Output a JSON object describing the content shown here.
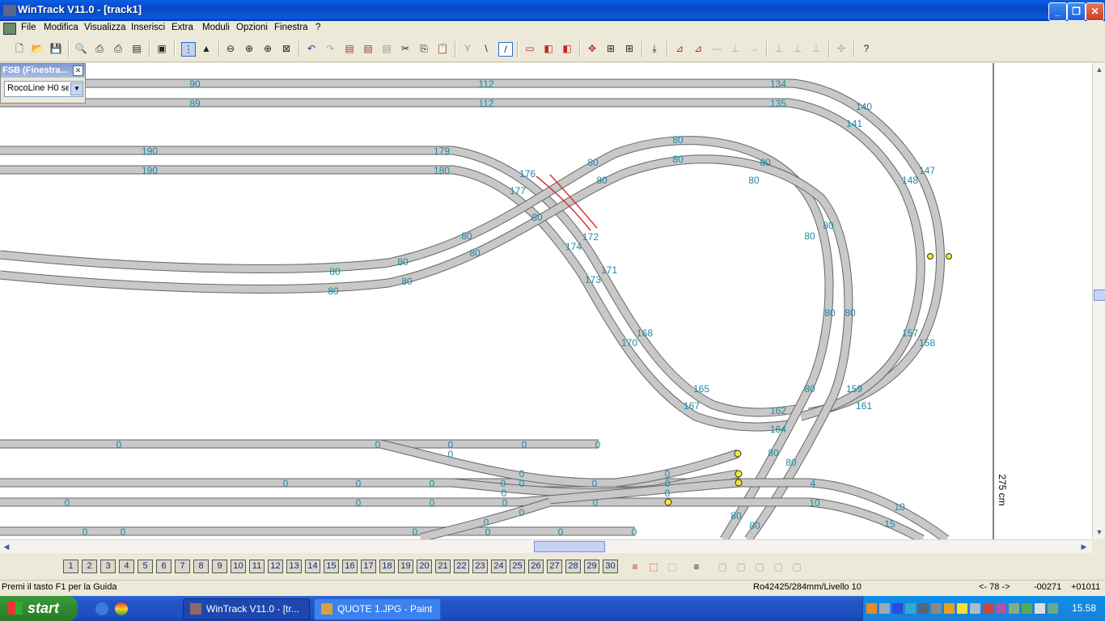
{
  "window": {
    "title": "WinTrack  V11.0 - [track1]"
  },
  "menu": [
    "File",
    "Modifica",
    "Visualizza",
    "Inserisci",
    "Extra",
    "Moduli",
    "Opzioni",
    "Finestra",
    "?"
  ],
  "fsb": {
    "title": "FSB (Finestra...",
    "selected": "RocoLine H0 se"
  },
  "track_labels": [
    "90",
    "112",
    "134",
    "89",
    "112",
    "135",
    "140",
    "141",
    "148",
    "147",
    "190",
    "179",
    "190",
    "180",
    "176",
    "177",
    "172",
    "174",
    "171",
    "173",
    "168",
    "170",
    "165",
    "167",
    "162",
    "164",
    "159",
    "161",
    "157",
    "158",
    "80",
    "0",
    "4",
    "10",
    "15"
  ],
  "ruler": "275 cm",
  "layers": [
    "1",
    "2",
    "3",
    "4",
    "5",
    "6",
    "7",
    "8",
    "9",
    "10",
    "11",
    "12",
    "13",
    "14",
    "15",
    "16",
    "17",
    "18",
    "19",
    "20",
    "21",
    "22",
    "23",
    "24",
    "25",
    "26",
    "27",
    "28",
    "29",
    "30"
  ],
  "status": {
    "help": "Premi il tasto F1 per la Guida",
    "piece": "Ro42425/284mm/Livello 10",
    "angle": "<- 78 ->",
    "x": "-00271",
    "y": "+01011"
  },
  "taskbar": {
    "start": "start",
    "tasks": [
      "WinTrack  V11.0 - [tr...",
      "QUOTE 1.JPG - Paint"
    ],
    "clock": "15.58"
  },
  "colors": {
    "label": "#1a8aa5",
    "track": "#c8c8c8",
    "selection": "#e03030",
    "titlebar": "#0a5fe5"
  }
}
